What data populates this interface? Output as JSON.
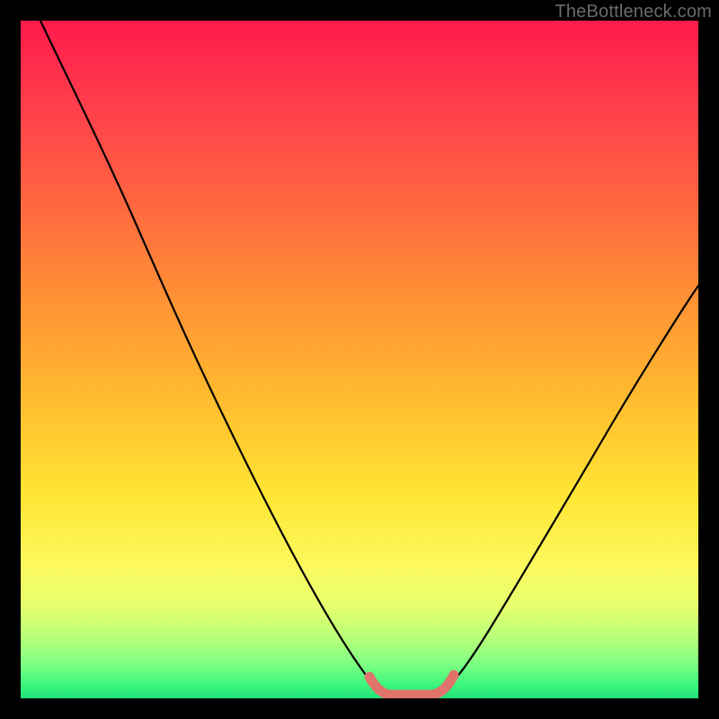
{
  "watermark": "TheBottleneck.com",
  "chart_data": {
    "type": "line",
    "title": "",
    "xlabel": "",
    "ylabel": "",
    "xlim": [
      0,
      100
    ],
    "ylim": [
      0,
      100
    ],
    "series": [
      {
        "name": "bottleneck-curve",
        "x": [
          3,
          10,
          20,
          30,
          40,
          48,
          52,
          55,
          60,
          65,
          75,
          85,
          95,
          100
        ],
        "values": [
          100,
          86,
          68,
          50,
          32,
          14,
          4,
          0,
          0,
          3,
          18,
          34,
          50,
          58
        ]
      }
    ],
    "highlight": {
      "name": "tolerance-band",
      "color": "#e0746c",
      "x": [
        53,
        55,
        60,
        63
      ],
      "values": [
        3,
        0,
        0,
        3
      ]
    },
    "background_gradient": {
      "top": "#ff1a4b",
      "mid": "#ffe534",
      "bottom": "#23e27a"
    }
  }
}
